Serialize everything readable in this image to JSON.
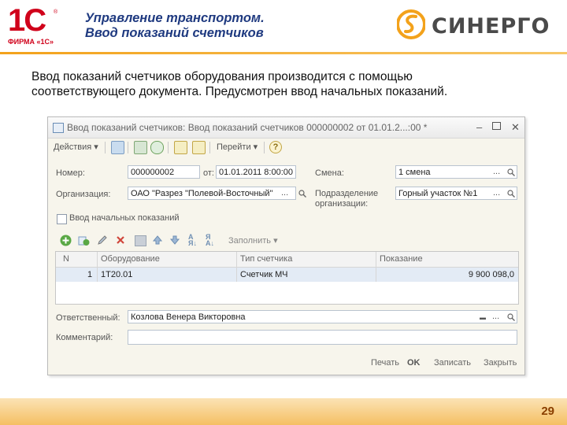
{
  "header": {
    "title_line1": "Управление транспортом.",
    "title_line2": "Ввод показаний счетчиков",
    "logo_1c_text": "1С",
    "logo_1c_sub": "ФИРМА «1С»",
    "partner_logo": "СИНЕРГО",
    "accent_color": "#f3a21b"
  },
  "intro": {
    "line1": "Ввод показаний счетчиков оборудования производится с помощью",
    "line2": "соответствующего документа. Предусмотрен ввод начальных показаний."
  },
  "window": {
    "title": "Ввод показаний счетчиков: Ввод показаний счетчиков 000000002 от 01.01.2...:00 *",
    "toolbar": {
      "actions": "Действия",
      "goto": "Перейти",
      "help": "?"
    },
    "form": {
      "number_label": "Номер:",
      "number_value": "000000002",
      "date_label": "от:",
      "date_value": "01.01.2011  8:00:00",
      "shift_label": "Смена:",
      "shift_value": "1 смена",
      "org_label": "Организация:",
      "org_value": "ОАО \"Разрез \"Полевой-Восточный\"",
      "dept_label_1": "Подразделение",
      "dept_label_2": "организации:",
      "dept_value": "Горный участок №1",
      "initial_label": "Ввод начальных показаний",
      "fill_label": "Заполнить",
      "responsible_label": "Ответственный:",
      "responsible_value": "Козлова Венера Викторовна",
      "comment_label": "Комментарий:",
      "comment_value": ""
    },
    "table": {
      "columns": [
        "N",
        "Оборудование",
        "Тип счетчика",
        "Показание"
      ],
      "rows": [
        {
          "n": "1",
          "equipment": "1Т20.01",
          "meter_type": "Счетчик МЧ",
          "reading": "9 900 098,0"
        }
      ]
    },
    "buttons": {
      "print": "Печать",
      "ok": "OK",
      "save": "Записать",
      "close": "Закрыть"
    }
  },
  "page_number": "29"
}
